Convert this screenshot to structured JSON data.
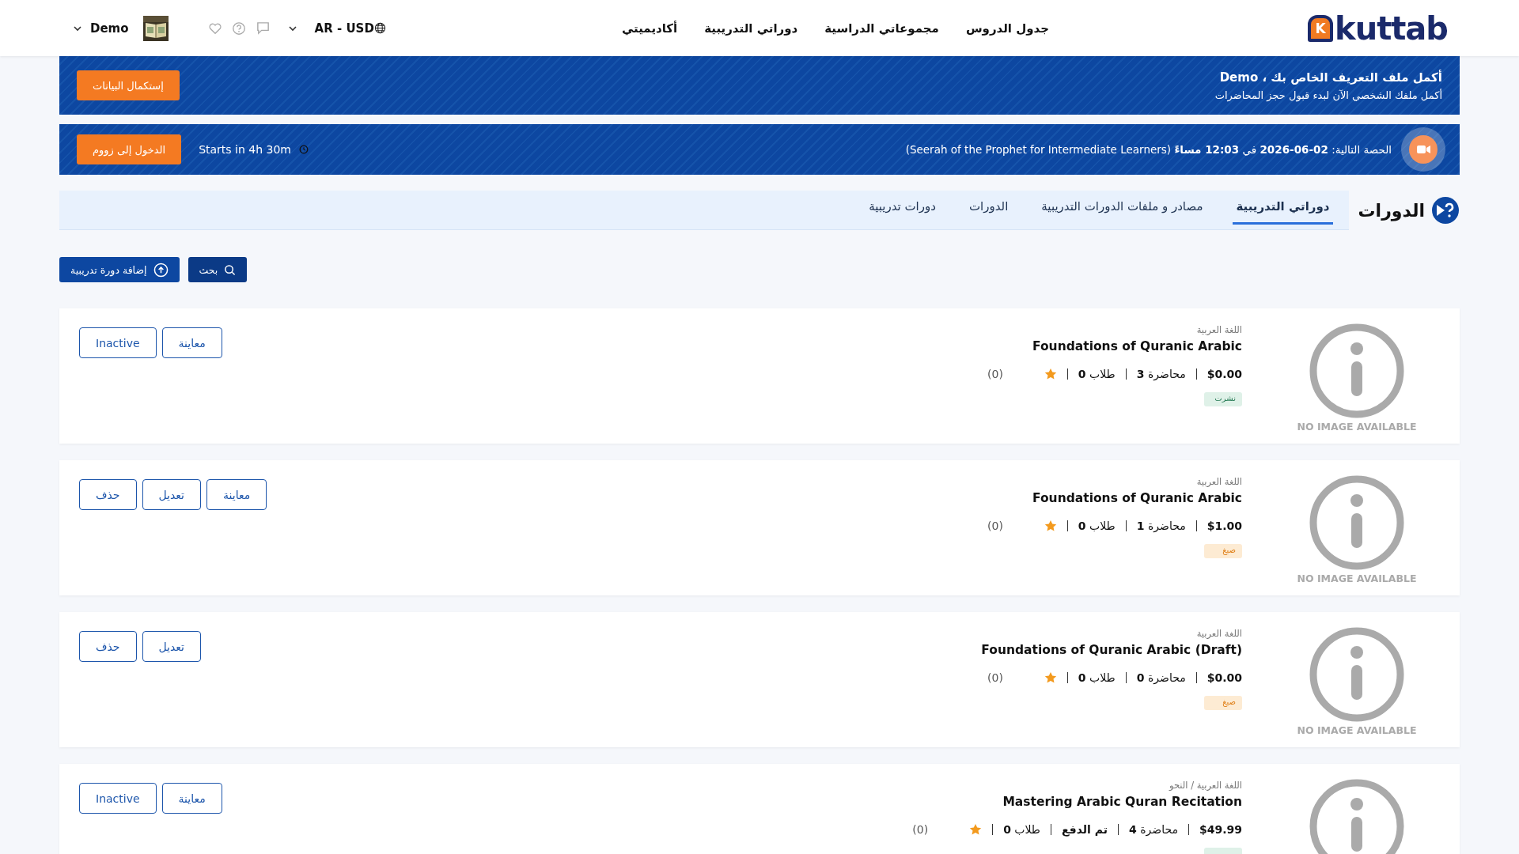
{
  "header": {
    "logo": {
      "mark": "K",
      "text": "kuttab"
    },
    "nav": [
      "جدول الدروس",
      "مجموعاتي الدراسية",
      "دوراتي التدريبية",
      "أكاديميتي"
    ],
    "locale": "AR - USD",
    "user": "Demo"
  },
  "profile_banner": {
    "title": "أكمل ملف التعريف الخاص بك ، Demo",
    "subtitle": "أكمل ملفك الشخصي الآن لبدء قبول حجز المحاضرات",
    "button": "إستكمال البيانات"
  },
  "session_banner": {
    "text": "الحصة التالية: **02-06-2026** في **12:03 مساءً** (Seerah of the Prophet for Intermediate Learners)",
    "countdown": "Starts in 4h 30m",
    "button": "الدخول إلى زووم"
  },
  "page_title": "الدورات",
  "tabs": [
    {
      "label": "دوراتي التدريبية",
      "selected": true
    },
    {
      "label": "مصادر و ملفات الدورات التدريبية",
      "selected": false
    },
    {
      "label": "الدورات",
      "selected": false
    },
    {
      "label": "دورات تدريبية",
      "selected": false
    }
  ],
  "toolbar": {
    "search": "بحث",
    "add": "إضافة دورة تدريبية"
  },
  "courses": [
    {
      "placeholder": "NO IMAGE AVAILABLE",
      "category": "اللغة العربية",
      "title": "Foundations of Quranic Arabic",
      "meta": [
        "$0.00",
        "محاضرة **3**",
        "طلاب **0**"
      ],
      "rating": "(0)",
      "status": {
        "kind": "published",
        "text": "نشرت"
      },
      "actions": [
        "معاينة",
        "Inactive"
      ]
    },
    {
      "placeholder": "NO IMAGE AVAILABLE",
      "category": "اللغة العربية",
      "title": "Foundations of Quranic Arabic",
      "meta": [
        "$1.00",
        "محاضرة **1**",
        "طلاب **0**"
      ],
      "rating": "(0)",
      "status": {
        "kind": "draft",
        "text": "صيغ"
      },
      "actions": [
        "معاينة",
        "تعديل",
        "حذف"
      ]
    },
    {
      "placeholder": "NO IMAGE AVAILABLE",
      "category": "اللغة العربية",
      "title": "Foundations of Quranic Arabic (Draft)",
      "meta": [
        "$0.00",
        "محاضرة **0**",
        "طلاب **0**"
      ],
      "rating": "(0)",
      "status": {
        "kind": "draft",
        "text": "صيغ"
      },
      "actions": [
        "تعديل",
        "حذف"
      ]
    },
    {
      "category": "اللغة العربية / النحو",
      "title": "Mastering Arabic Quran Recitation",
      "meta": [
        "$49.99",
        "محاضرة **4**",
        "**تم الدفع**",
        "طلاب **0**"
      ],
      "rating": "(0)",
      "status": {
        "kind": "published"
      },
      "actions": [
        "معاينة",
        "Inactive"
      ]
    }
  ]
}
